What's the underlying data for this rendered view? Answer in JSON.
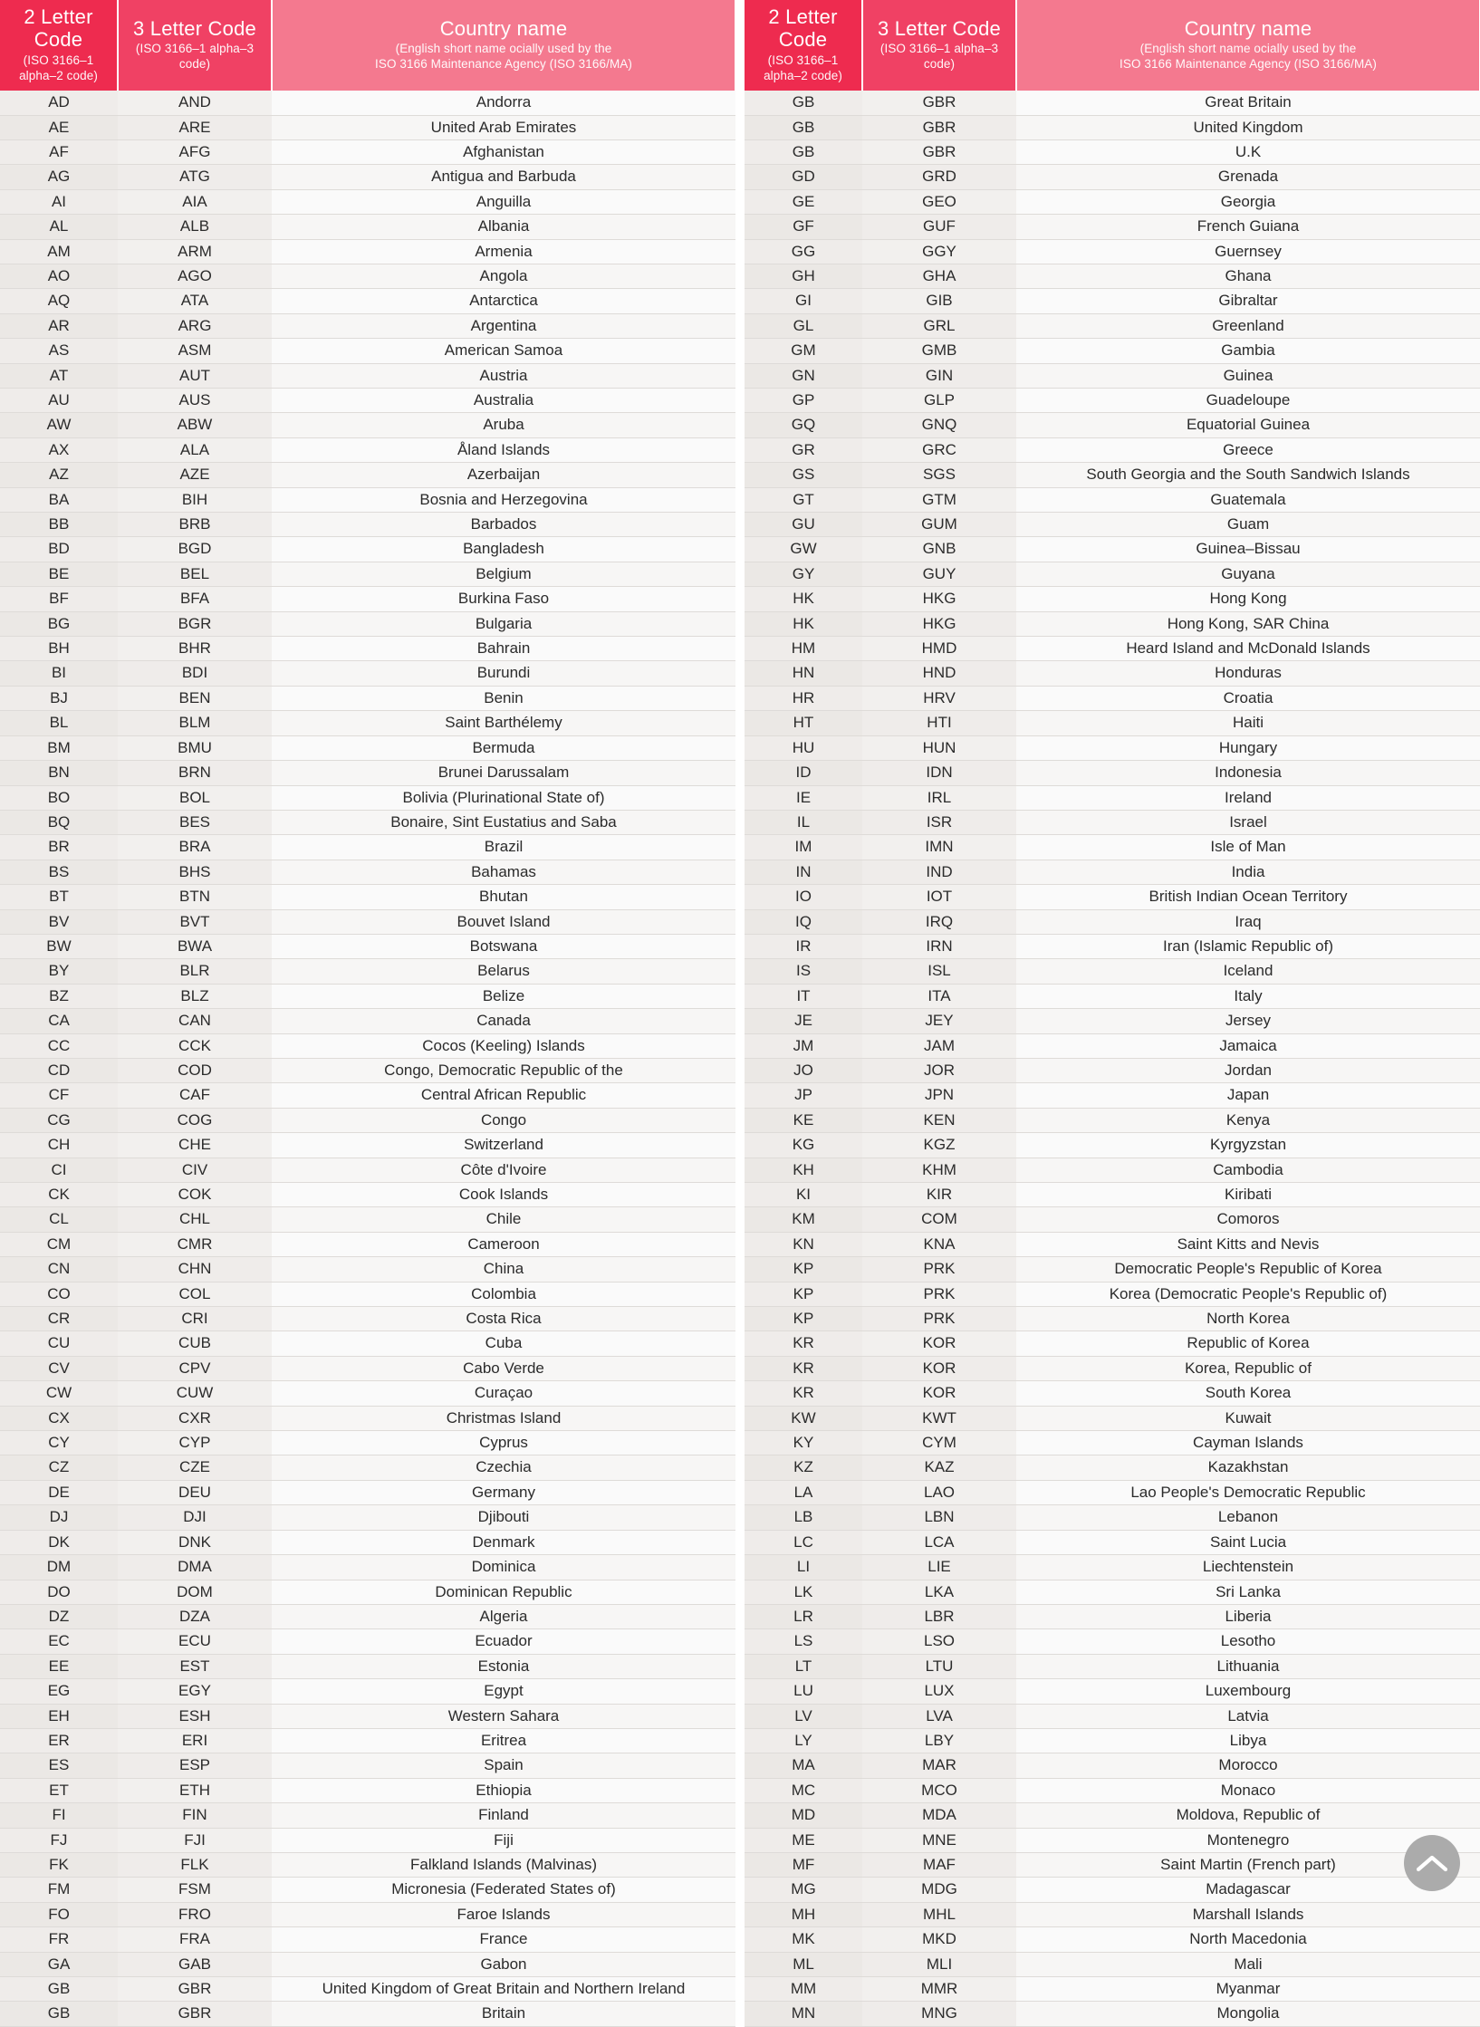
{
  "header": {
    "col_code2_title": "2 Letter Code",
    "col_code2_sub": "(ISO 3166–1 alpha–2 code)",
    "col_code3_title": "3 Letter Code",
    "col_code3_sub": "(ISO 3166–1 alpha–3 code)",
    "col_name_title": "Country name",
    "col_name_sub_line1": "(English short name ocially used by the",
    "col_name_sub_line2": "ISO 3166 Maintenance Agency (ISO 3166/MA)"
  },
  "colors": {
    "header_code2": "#ee2b4f",
    "header_code3": "#f04164",
    "header_name": "#f4798f",
    "row_odd_code": "#efecea",
    "row_even_code": "#ebe8e5",
    "row_name": "#fafafa",
    "row_border": "#dedbd8",
    "text": "#2b2b2b",
    "scroll_button": "#ababab"
  },
  "controls": {
    "scroll_top_icon": "chevron-up-icon"
  },
  "left_table": {
    "rows": [
      [
        "AD",
        "AND",
        "Andorra"
      ],
      [
        "AE",
        "ARE",
        "United Arab Emirates"
      ],
      [
        "AF",
        "AFG",
        "Afghanistan"
      ],
      [
        "AG",
        "ATG",
        "Antigua and Barbuda"
      ],
      [
        "AI",
        "AIA",
        "Anguilla"
      ],
      [
        "AL",
        "ALB",
        "Albania"
      ],
      [
        "AM",
        "ARM",
        "Armenia"
      ],
      [
        "AO",
        "AGO",
        "Angola"
      ],
      [
        "AQ",
        "ATA",
        "Antarctica"
      ],
      [
        "AR",
        "ARG",
        "Argentina"
      ],
      [
        "AS",
        "ASM",
        "American Samoa"
      ],
      [
        "AT",
        "AUT",
        "Austria"
      ],
      [
        "AU",
        "AUS",
        "Australia"
      ],
      [
        "AW",
        "ABW",
        "Aruba"
      ],
      [
        "AX",
        "ALA",
        "Åland Islands"
      ],
      [
        "AZ",
        "AZE",
        "Azerbaijan"
      ],
      [
        "BA",
        "BIH",
        "Bosnia and Herzegovina"
      ],
      [
        "BB",
        "BRB",
        "Barbados"
      ],
      [
        "BD",
        "BGD",
        "Bangladesh"
      ],
      [
        "BE",
        "BEL",
        "Belgium"
      ],
      [
        "BF",
        "BFA",
        "Burkina Faso"
      ],
      [
        "BG",
        "BGR",
        "Bulgaria"
      ],
      [
        "BH",
        "BHR",
        "Bahrain"
      ],
      [
        "BI",
        "BDI",
        "Burundi"
      ],
      [
        "BJ",
        "BEN",
        "Benin"
      ],
      [
        "BL",
        "BLM",
        "Saint Barthélemy"
      ],
      [
        "BM",
        "BMU",
        "Bermuda"
      ],
      [
        "BN",
        "BRN",
        "Brunei Darussalam"
      ],
      [
        "BO",
        "BOL",
        "Bolivia (Plurinational State of)"
      ],
      [
        "BQ",
        "BES",
        "Bonaire, Sint Eustatius and Saba"
      ],
      [
        "BR",
        "BRA",
        "Brazil"
      ],
      [
        "BS",
        "BHS",
        "Bahamas"
      ],
      [
        "BT",
        "BTN",
        "Bhutan"
      ],
      [
        "BV",
        "BVT",
        "Bouvet Island"
      ],
      [
        "BW",
        "BWA",
        "Botswana"
      ],
      [
        "BY",
        "BLR",
        "Belarus"
      ],
      [
        "BZ",
        "BLZ",
        "Belize"
      ],
      [
        "CA",
        "CAN",
        "Canada"
      ],
      [
        "CC",
        "CCK",
        "Cocos (Keeling) Islands"
      ],
      [
        "CD",
        "COD",
        "Congo, Democratic Republic of the"
      ],
      [
        "CF",
        "CAF",
        "Central African Republic"
      ],
      [
        "CG",
        "COG",
        "Congo"
      ],
      [
        "CH",
        "CHE",
        "Switzerland"
      ],
      [
        "CI",
        "CIV",
        "Côte d'Ivoire"
      ],
      [
        "CK",
        "COK",
        "Cook Islands"
      ],
      [
        "CL",
        "CHL",
        "Chile"
      ],
      [
        "CM",
        "CMR",
        "Cameroon"
      ],
      [
        "CN",
        "CHN",
        "China"
      ],
      [
        "CO",
        "COL",
        "Colombia"
      ],
      [
        "CR",
        "CRI",
        "Costa Rica"
      ],
      [
        "CU",
        "CUB",
        "Cuba"
      ],
      [
        "CV",
        "CPV",
        "Cabo Verde"
      ],
      [
        "CW",
        "CUW",
        "Curaçao"
      ],
      [
        "CX",
        "CXR",
        "Christmas Island"
      ],
      [
        "CY",
        "CYP",
        "Cyprus"
      ],
      [
        "CZ",
        "CZE",
        "Czechia"
      ],
      [
        "DE",
        "DEU",
        "Germany"
      ],
      [
        "DJ",
        "DJI",
        "Djibouti"
      ],
      [
        "DK",
        "DNK",
        "Denmark"
      ],
      [
        "DM",
        "DMA",
        "Dominica"
      ],
      [
        "DO",
        "DOM",
        "Dominican Republic"
      ],
      [
        "DZ",
        "DZA",
        "Algeria"
      ],
      [
        "EC",
        "ECU",
        "Ecuador"
      ],
      [
        "EE",
        "EST",
        "Estonia"
      ],
      [
        "EG",
        "EGY",
        "Egypt"
      ],
      [
        "EH",
        "ESH",
        "Western Sahara"
      ],
      [
        "ER",
        "ERI",
        "Eritrea"
      ],
      [
        "ES",
        "ESP",
        "Spain"
      ],
      [
        "ET",
        "ETH",
        "Ethiopia"
      ],
      [
        "FI",
        "FIN",
        "Finland"
      ],
      [
        "FJ",
        "FJI",
        "Fiji"
      ],
      [
        "FK",
        "FLK",
        "Falkland Islands (Malvinas)"
      ],
      [
        "FM",
        "FSM",
        "Micronesia (Federated States of)"
      ],
      [
        "FO",
        "FRO",
        "Faroe Islands"
      ],
      [
        "FR",
        "FRA",
        "France"
      ],
      [
        "GA",
        "GAB",
        "Gabon"
      ],
      [
        "GB",
        "GBR",
        "United Kingdom of Great Britain and Northern Ireland"
      ],
      [
        "GB",
        "GBR",
        "Britain"
      ]
    ]
  },
  "right_table": {
    "rows": [
      [
        "GB",
        "GBR",
        "Great Britain"
      ],
      [
        "GB",
        "GBR",
        "United Kingdom"
      ],
      [
        "GB",
        "GBR",
        "U.K"
      ],
      [
        "GD",
        "GRD",
        "Grenada"
      ],
      [
        "GE",
        "GEO",
        "Georgia"
      ],
      [
        "GF",
        "GUF",
        "French Guiana"
      ],
      [
        "GG",
        "GGY",
        "Guernsey"
      ],
      [
        "GH",
        "GHA",
        "Ghana"
      ],
      [
        "GI",
        "GIB",
        "Gibraltar"
      ],
      [
        "GL",
        "GRL",
        "Greenland"
      ],
      [
        "GM",
        "GMB",
        "Gambia"
      ],
      [
        "GN",
        "GIN",
        "Guinea"
      ],
      [
        "GP",
        "GLP",
        "Guadeloupe"
      ],
      [
        "GQ",
        "GNQ",
        "Equatorial Guinea"
      ],
      [
        "GR",
        "GRC",
        "Greece"
      ],
      [
        "GS",
        "SGS",
        "South Georgia and the South Sandwich Islands"
      ],
      [
        "GT",
        "GTM",
        "Guatemala"
      ],
      [
        "GU",
        "GUM",
        "Guam"
      ],
      [
        "GW",
        "GNB",
        "Guinea–Bissau"
      ],
      [
        "GY",
        "GUY",
        "Guyana"
      ],
      [
        "HK",
        "HKG",
        "Hong Kong"
      ],
      [
        "HK",
        "HKG",
        "Hong Kong, SAR China"
      ],
      [
        "HM",
        "HMD",
        "Heard Island and McDonald Islands"
      ],
      [
        "HN",
        "HND",
        "Honduras"
      ],
      [
        "HR",
        "HRV",
        "Croatia"
      ],
      [
        "HT",
        "HTI",
        "Haiti"
      ],
      [
        "HU",
        "HUN",
        "Hungary"
      ],
      [
        "ID",
        "IDN",
        "Indonesia"
      ],
      [
        "IE",
        "IRL",
        "Ireland"
      ],
      [
        "IL",
        "ISR",
        "Israel"
      ],
      [
        "IM",
        "IMN",
        "Isle of Man"
      ],
      [
        "IN",
        "IND",
        "India"
      ],
      [
        "IO",
        "IOT",
        "British Indian Ocean Territory"
      ],
      [
        "IQ",
        "IRQ",
        "Iraq"
      ],
      [
        "IR",
        "IRN",
        "Iran (Islamic Republic of)"
      ],
      [
        "IS",
        "ISL",
        "Iceland"
      ],
      [
        "IT",
        "ITA",
        "Italy"
      ],
      [
        "JE",
        "JEY",
        "Jersey"
      ],
      [
        "JM",
        "JAM",
        "Jamaica"
      ],
      [
        "JO",
        "JOR",
        "Jordan"
      ],
      [
        "JP",
        "JPN",
        "Japan"
      ],
      [
        "KE",
        "KEN",
        "Kenya"
      ],
      [
        "KG",
        "KGZ",
        "Kyrgyzstan"
      ],
      [
        "KH",
        "KHM",
        "Cambodia"
      ],
      [
        "KI",
        "KIR",
        "Kiribati"
      ],
      [
        "KM",
        "COM",
        "Comoros"
      ],
      [
        "KN",
        "KNA",
        "Saint Kitts and Nevis"
      ],
      [
        "KP",
        "PRK",
        "Democratic People's Republic of Korea"
      ],
      [
        "KP",
        "PRK",
        "Korea (Democratic People's Republic of)"
      ],
      [
        "KP",
        "PRK",
        "North Korea"
      ],
      [
        "KR",
        "KOR",
        "Republic of Korea"
      ],
      [
        "KR",
        "KOR",
        "Korea, Republic of"
      ],
      [
        "KR",
        "KOR",
        "South Korea"
      ],
      [
        "KW",
        "KWT",
        "Kuwait"
      ],
      [
        "KY",
        "CYM",
        "Cayman Islands"
      ],
      [
        "KZ",
        "KAZ",
        "Kazakhstan"
      ],
      [
        "LA",
        "LAO",
        "Lao People's Democratic Republic"
      ],
      [
        "LB",
        "LBN",
        "Lebanon"
      ],
      [
        "LC",
        "LCA",
        "Saint Lucia"
      ],
      [
        "LI",
        "LIE",
        "Liechtenstein"
      ],
      [
        "LK",
        "LKA",
        "Sri Lanka"
      ],
      [
        "LR",
        "LBR",
        "Liberia"
      ],
      [
        "LS",
        "LSO",
        "Lesotho"
      ],
      [
        "LT",
        "LTU",
        "Lithuania"
      ],
      [
        "LU",
        "LUX",
        "Luxembourg"
      ],
      [
        "LV",
        "LVA",
        "Latvia"
      ],
      [
        "LY",
        "LBY",
        "Libya"
      ],
      [
        "MA",
        "MAR",
        "Morocco"
      ],
      [
        "MC",
        "MCO",
        "Monaco"
      ],
      [
        "MD",
        "MDA",
        "Moldova, Republic of"
      ],
      [
        "ME",
        "MNE",
        "Montenegro"
      ],
      [
        "MF",
        "MAF",
        "Saint Martin (French part)"
      ],
      [
        "MG",
        "MDG",
        "Madagascar"
      ],
      [
        "MH",
        "MHL",
        "Marshall Islands"
      ],
      [
        "MK",
        "MKD",
        "North Macedonia"
      ],
      [
        "ML",
        "MLI",
        "Mali"
      ],
      [
        "MM",
        "MMR",
        "Myanmar"
      ],
      [
        "MN",
        "MNG",
        "Mongolia"
      ]
    ]
  }
}
